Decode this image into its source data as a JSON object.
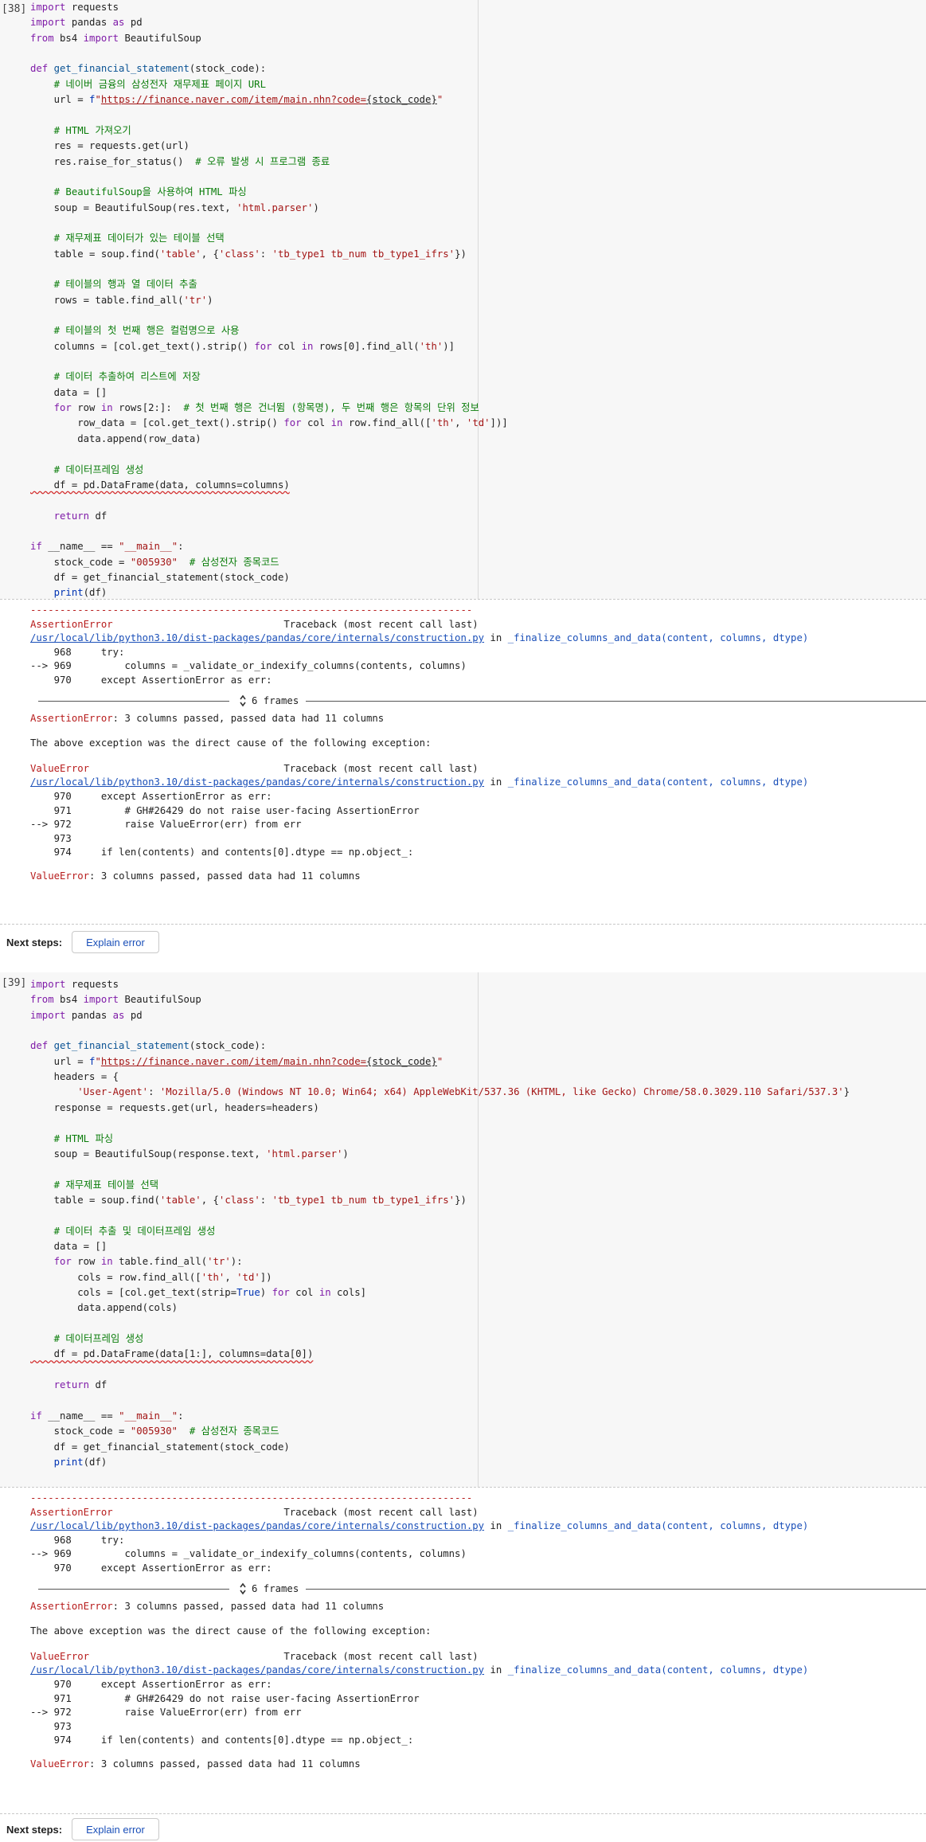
{
  "cells": [
    {
      "exec_count": "[38]",
      "code": [
        "import requests",
        "import pandas as pd",
        "from bs4 import BeautifulSoup",
        "",
        "def get_financial_statement(stock_code):",
        "    # 네이버 금융의 삼성전자 재무제표 페이지 URL",
        "    url = f\"https://finance.naver.com/item/main.nhn?code={stock_code}\"",
        "",
        "    # HTML 가져오기",
        "    res = requests.get(url)",
        "    res.raise_for_status()  # 오류 발생 시 프로그램 종료",
        "",
        "    # BeautifulSoup을 사용하여 HTML 파싱",
        "    soup = BeautifulSoup(res.text, 'html.parser')",
        "",
        "    # 재무제표 데이터가 있는 테이블 선택",
        "    table = soup.find('table', {'class': 'tb_type1 tb_num tb_type1_ifrs'})",
        "",
        "    # 테이블의 행과 열 데이터 추출",
        "    rows = table.find_all('tr')",
        "",
        "    # 테이블의 첫 번째 행은 컬럼명으로 사용",
        "    columns = [col.get_text().strip() for col in rows[0].find_all('th')]",
        "",
        "    # 데이터 추출하여 리스트에 저장",
        "    data = []",
        "    for row in rows[2:]:  # 첫 번째 행은 건너뜀 (항목명), 두 번째 행은 항목의 단위 정보",
        "        row_data = [col.get_text().strip() for col in row.find_all(['th', 'td'])]",
        "        data.append(row_data)",
        "",
        "    # 데이터프레임 생성",
        "    df = pd.DataFrame(data, columns=columns)",
        "",
        "    return df",
        "",
        "if __name__ == \"__main__\":",
        "    stock_code = \"005930\"  # 삼성전자 종목코드",
        "    df = get_financial_statement(stock_code)",
        "    print(df)"
      ],
      "output": {
        "dashes": "---------------------------------------------------------------------------",
        "err1_name": "AssertionError",
        "err1_tb": "Traceback (most recent call last)",
        "file_path": "/usr/local/lib/python3.10/dist-packages/pandas/core/internals/construction.py",
        "in_word": "in",
        "func_name": "_finalize_columns_and_data",
        "func_args": "(content, columns, dtype)",
        "tb1_lines": [
          "    968     try:",
          "--> 969         columns = _validate_or_indexify_columns(contents, columns)",
          "    970     except AssertionError as err:"
        ],
        "frames_label": "6 frames",
        "assert_msg_name": "AssertionError",
        "assert_msg": ": 3 columns passed, passed data had 11 columns",
        "cause_text": "The above exception was the direct cause of the following exception:",
        "err2_name": "ValueError",
        "err2_tb": "Traceback (most recent call last)",
        "tb2_lines": [
          "    970     except AssertionError as err:",
          "    971         # GH#26429 do not raise user-facing AssertionError",
          "--> 972         raise ValueError(err) from err",
          "    973",
          "    974     if len(contents) and contents[0].dtype == np.object_:"
        ],
        "value_msg_name": "ValueError",
        "value_msg": ": 3 columns passed, passed data had 11 columns"
      },
      "next_steps_label": "Next steps:",
      "explain_label": "Explain error"
    },
    {
      "exec_count": "[39]",
      "code": [
        "import requests",
        "from bs4 import BeautifulSoup",
        "import pandas as pd",
        "",
        "def get_financial_statement(stock_code):",
        "    url = f\"https://finance.naver.com/item/main.nhn?code={stock_code}\"",
        "    headers = {",
        "        'User-Agent': 'Mozilla/5.0 (Windows NT 10.0; Win64; x64) AppleWebKit/537.36 (KHTML, like Gecko) Chrome/58.0.3029.110 Safari/537.3'}",
        "    response = requests.get(url, headers=headers)",
        "",
        "    # HTML 파싱",
        "    soup = BeautifulSoup(response.text, 'html.parser')",
        "",
        "    # 재무제표 테이블 선택",
        "    table = soup.find('table', {'class': 'tb_type1 tb_num tb_type1_ifrs'})",
        "",
        "    # 데이터 추출 및 데이터프레임 생성",
        "    data = []",
        "    for row in table.find_all('tr'):",
        "        cols = row.find_all(['th', 'td'])",
        "        cols = [col.get_text(strip=True) for col in cols]",
        "        data.append(cols)",
        "",
        "    # 데이터프레임 생성",
        "    df = pd.DataFrame(data[1:], columns=data[0])",
        "",
        "    return df",
        "",
        "if __name__ == \"__main__\":",
        "    stock_code = \"005930\"  # 삼성전자 종목코드",
        "    df = get_financial_statement(stock_code)",
        "    print(df)"
      ],
      "output": {
        "dashes": "---------------------------------------------------------------------------",
        "err1_name": "AssertionError",
        "err1_tb": "Traceback (most recent call last)",
        "file_path": "/usr/local/lib/python3.10/dist-packages/pandas/core/internals/construction.py",
        "in_word": "in",
        "func_name": "_finalize_columns_and_data",
        "func_args": "(content, columns, dtype)",
        "tb1_lines": [
          "    968     try:",
          "--> 969         columns = _validate_or_indexify_columns(contents, columns)",
          "    970     except AssertionError as err:"
        ],
        "frames_label": "6 frames",
        "assert_msg_name": "AssertionError",
        "assert_msg": ": 3 columns passed, passed data had 11 columns",
        "cause_text": "The above exception was the direct cause of the following exception:",
        "err2_name": "ValueError",
        "err2_tb": "Traceback (most recent call last)",
        "tb2_lines": [
          "    970     except AssertionError as err:",
          "    971         # GH#26429 do not raise user-facing AssertionError",
          "--> 972         raise ValueError(err) from err",
          "    973",
          "    974     if len(contents) and contents[0].dtype == np.object_:"
        ],
        "value_msg_name": "ValueError",
        "value_msg": ": 3 columns passed, passed data had 11 columns"
      },
      "next_steps_label": "Next steps:",
      "explain_label": "Explain error"
    }
  ]
}
